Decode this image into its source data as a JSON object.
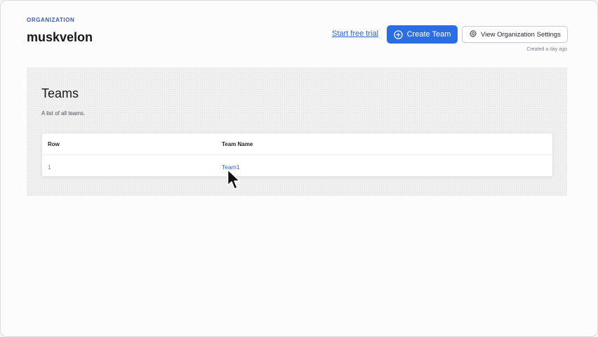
{
  "header": {
    "section_label": "ORGANIZATION",
    "org_name": "muskvelon",
    "trial_link": "Start free trial",
    "create_team_label": "Create Team",
    "settings_label": "View Organization Settings",
    "created_text": "Created a day ago"
  },
  "teams": {
    "title": "Teams",
    "description": "A list of all teams.",
    "columns": [
      "Row",
      "Team Name"
    ],
    "rows": [
      {
        "row": "1",
        "team_name": "Team1"
      }
    ]
  },
  "icons": {
    "create": "plus-circle-icon",
    "settings": "gear-icon",
    "pointer": "mouse-pointer-icon"
  },
  "colors": {
    "primary": "#2b6de2",
    "link": "#2a63d8",
    "section_label": "#3d5ba9"
  }
}
